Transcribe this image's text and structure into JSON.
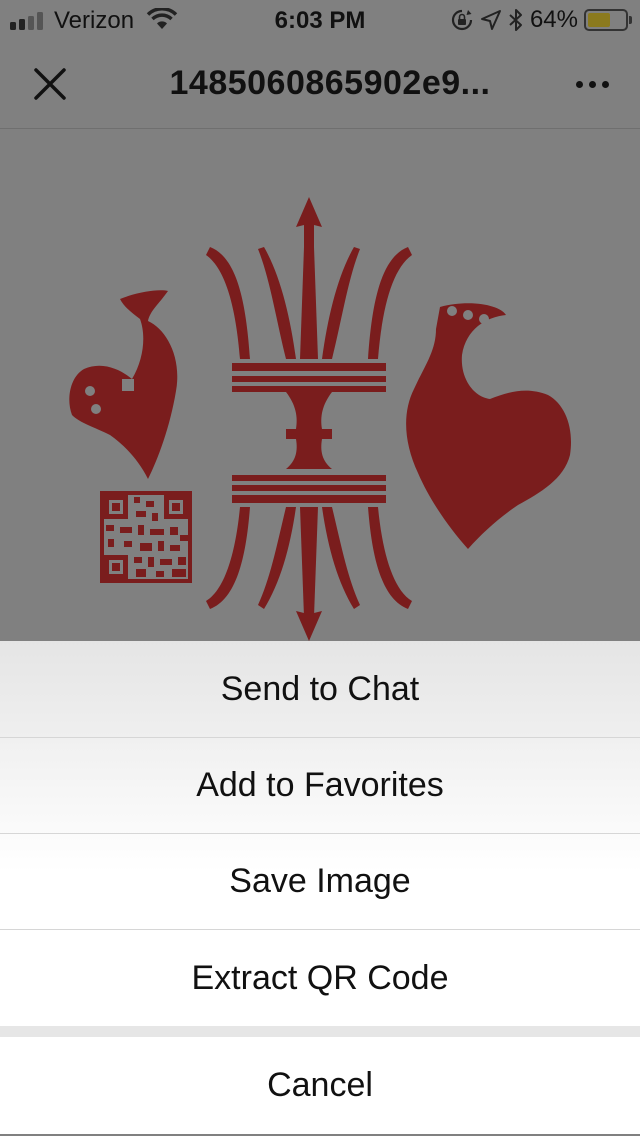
{
  "status_bar": {
    "carrier": "Verizon",
    "time": "6:03 PM",
    "battery_percent": "64%",
    "battery_level": 0.64,
    "battery_color": "#8b7a1e"
  },
  "nav_bar": {
    "title": "1485060865902e9...",
    "close_icon": "close-icon",
    "more_icon": "more-icon"
  },
  "image": {
    "accent_color": "#8b1f1f",
    "description_icons": [
      "trident-icon",
      "rooster-icon",
      "qr-code-icon"
    ]
  },
  "action_sheet": {
    "items": [
      {
        "label": "Send to Chat"
      },
      {
        "label": "Add to Favorites"
      },
      {
        "label": "Save Image"
      },
      {
        "label": "Extract QR Code"
      }
    ],
    "cancel_label": "Cancel"
  }
}
